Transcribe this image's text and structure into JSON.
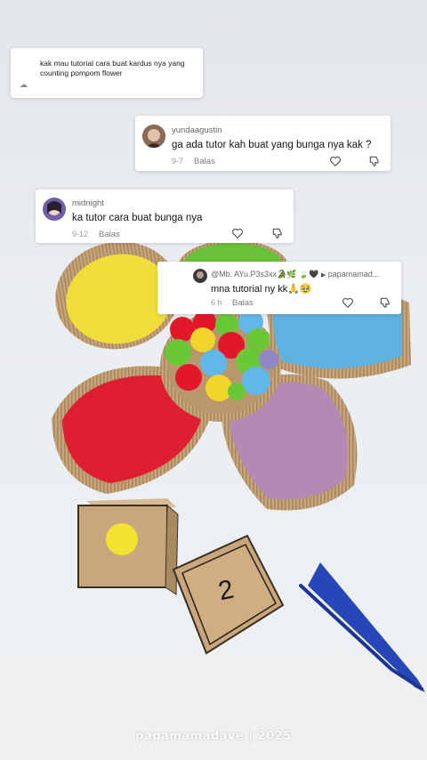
{
  "reply_bubble": {
    "text": "kak mau tutorial cara buat kardus nya yang counting pompom flower"
  },
  "comments": [
    {
      "username": "yundaagustin",
      "text": "ga ada tutor kah buat yang bunga nya kak ?",
      "date": "9-7",
      "reply_label": "Balas"
    },
    {
      "username": "midnight",
      "text": "ka tutor cara buat bunga nya",
      "date": "9-12",
      "reply_label": "Balas"
    },
    {
      "username": "@Mb. AYu.P3s3xx",
      "username_suffix": "🐊🌿 🍃🖤",
      "reply_to": "papamamad...",
      "text": "mna tutorial ny kk🙏🥹",
      "date": "6 h",
      "reply_label": "Balas"
    }
  ],
  "dice": {
    "face_number": "2"
  },
  "watermark": "papamamadave | 2025",
  "colors": {
    "petal_yellow": "#f0dc3a",
    "petal_green": "#69c23a",
    "petal_blue": "#5fb2df",
    "petal_purple": "#b38ab4",
    "petal_red": "#dd1f31",
    "cardboard": "#c9a77c",
    "tweezers": "#2747b8"
  }
}
